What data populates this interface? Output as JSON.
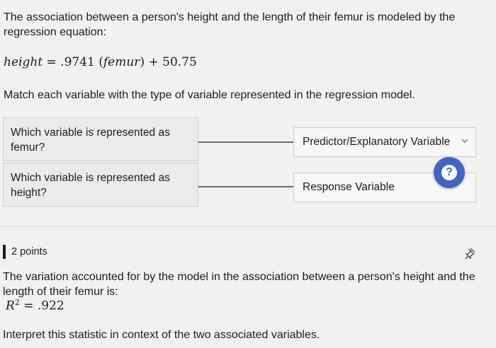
{
  "question1": {
    "intro": "The association between a person's height and the length of their femur is modeled by the regression equation:",
    "equation": {
      "lhs": "height",
      "rhs_coef": ".9741",
      "rhs_var": "femur",
      "rhs_const": "50.75"
    },
    "instruction": "Match each variable with the type of variable represented in the regression model.",
    "prompts": [
      "Which variable is represented as femur?",
      "Which variable is represented as height?"
    ],
    "answers": [
      "Predictor/Explanatory Variable",
      "Response Variable"
    ]
  },
  "help_button": "?",
  "question2": {
    "points": "2 points",
    "text": "The variation accounted for by the model in the association between a person's height and the length of their femur is:",
    "r2_value": ".922",
    "interpret": "Interpret this statistic in context of the two associated variables."
  },
  "colors": {
    "accent": "#3d66c4",
    "background": "#f1f1ef"
  }
}
